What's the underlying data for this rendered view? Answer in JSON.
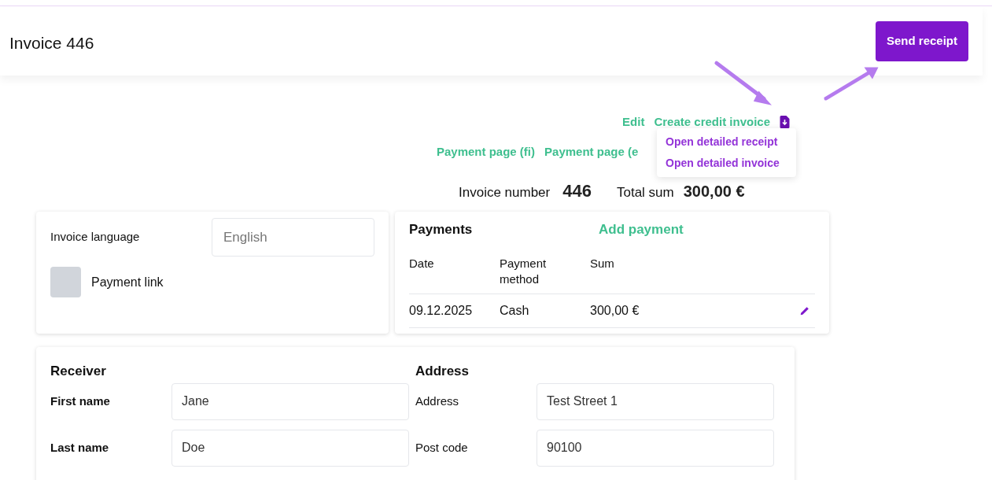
{
  "header": {
    "title": "Invoice 446",
    "send_button": "Send receipt"
  },
  "actions": {
    "links": [
      "Edit",
      "Create credit invoice"
    ],
    "payment_links": [
      "Payment page (fi)",
      "Payment page (e"
    ],
    "menu": {
      "items": [
        "Open detailed receipt",
        "Open detailed invoice"
      ]
    }
  },
  "summary": {
    "number_label": "Invoice number",
    "number": "446",
    "total_label": "Total sum",
    "total": "300,00 €"
  },
  "settings": {
    "language_label": "Invoice language",
    "language_placeholder": "English",
    "payment_link": {
      "label": "Payment link",
      "checked": false
    }
  },
  "payments": {
    "title": "Payments",
    "add_label": "Add payment",
    "columns": [
      "Date",
      "Payment method",
      "Sum"
    ],
    "rows": [
      {
        "date": "09.12.2025",
        "method": "Cash",
        "sum": "300,00 €"
      }
    ]
  },
  "receiver": {
    "title": "Receiver",
    "fields": [
      {
        "label": "First name",
        "value": "Jane"
      },
      {
        "label": "Last name",
        "value": "Doe"
      }
    ]
  },
  "address": {
    "title": "Address",
    "fields": [
      {
        "label": "Address",
        "value": "Test Street 1"
      },
      {
        "label": "Post code",
        "value": "90100"
      }
    ]
  }
}
